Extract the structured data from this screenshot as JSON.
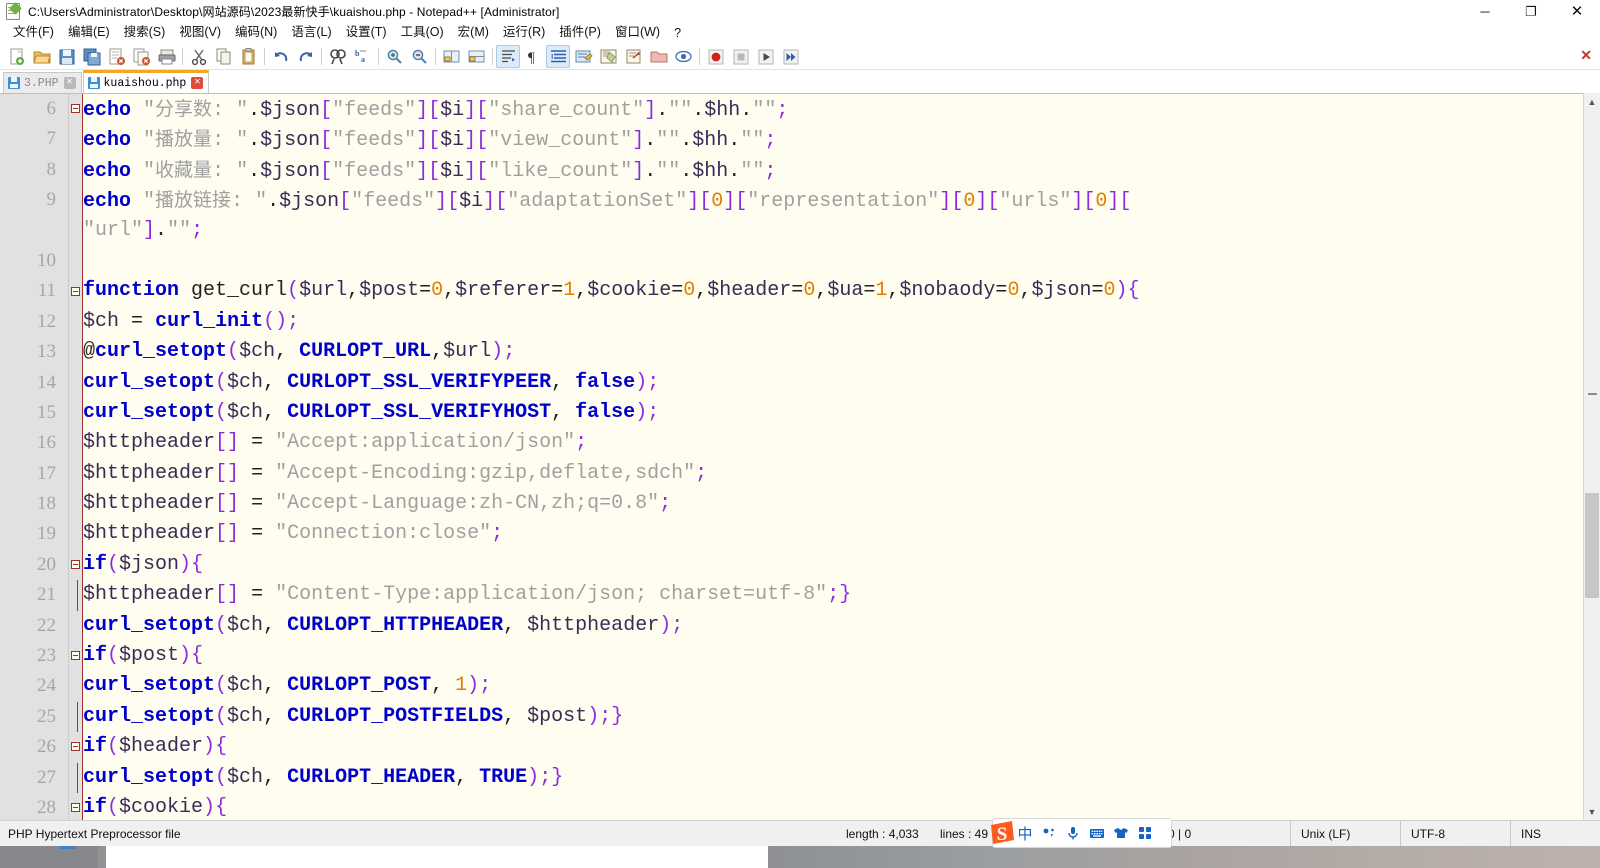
{
  "window": {
    "title": "C:\\Users\\Administrator\\Desktop\\网站源码\\2023最新快手\\kuaishou.php - Notepad++ [Administrator]",
    "app_icon": "notepad-plus-plus-icon",
    "minimize": "─",
    "maximize": "❐",
    "close": "✕"
  },
  "menu": {
    "items": [
      {
        "label": "文件(F)",
        "name": "menu-file"
      },
      {
        "label": "编辑(E)",
        "name": "menu-edit"
      },
      {
        "label": "搜索(S)",
        "name": "menu-search"
      },
      {
        "label": "视图(V)",
        "name": "menu-view"
      },
      {
        "label": "编码(N)",
        "name": "menu-encoding"
      },
      {
        "label": "语言(L)",
        "name": "menu-language"
      },
      {
        "label": "设置(T)",
        "name": "menu-settings"
      },
      {
        "label": "工具(O)",
        "name": "menu-tools"
      },
      {
        "label": "宏(M)",
        "name": "menu-macro"
      },
      {
        "label": "运行(R)",
        "name": "menu-run"
      },
      {
        "label": "插件(P)",
        "name": "menu-plugins"
      },
      {
        "label": "窗口(W)",
        "name": "menu-window"
      }
    ],
    "help": "?"
  },
  "toolbar": {
    "buttons": [
      "new-file-icon",
      "open-file-icon",
      "save-icon",
      "save-all-icon",
      "close-file-icon",
      "close-all-icon",
      "print-icon",
      "sep",
      "cut-icon",
      "copy-icon",
      "paste-icon",
      "sep",
      "undo-icon",
      "redo-icon",
      "sep",
      "find-icon",
      "replace-icon",
      "sep",
      "zoom-in-icon",
      "zoom-out-icon",
      "sep",
      "sync-vertical-icon",
      "sync-horizontal-icon",
      "sep",
      "word-wrap-icon",
      "show-all-chars-icon",
      "indent-guide-icon",
      "user-language-icon",
      "document-map-icon",
      "function-list-icon",
      "folder-as-workspace-icon",
      "monitoring-icon",
      "sep",
      "record-macro-icon",
      "stop-macro-icon",
      "play-macro-icon",
      "fast-play-macro-icon"
    ],
    "close_doc": "✕"
  },
  "tabs": [
    {
      "label": "3.PHP",
      "active": false,
      "name": "tab-3-php",
      "close": "✕"
    },
    {
      "label": "kuaishou.php",
      "active": true,
      "name": "tab-kuaishou-php",
      "close": "✕"
    }
  ],
  "editor": {
    "first_visible_line": 6,
    "language": "PHP",
    "lines": [
      {
        "num": "6",
        "fold": "open-box",
        "html": "<span class=\"kw\">echo</span> <span class=\"str\">\"</span><span class=\"cjk\">分享数</span><span class=\"str\">: \"</span><span class=\"op\">.</span><span class=\"var\">$json</span><span class=\"brk\">[</span><span class=\"str\">\"feeds\"</span><span class=\"brk\">][</span><span class=\"var\">$i</span><span class=\"brk\">][</span><span class=\"str\">\"share_count\"</span><span class=\"brk\">]</span><span class=\"op\">.</span><span class=\"str\">\"\"</span><span class=\"op\">.</span><span class=\"var\">$hh</span><span class=\"op\">.</span><span class=\"str\">\"\"</span><span class=\"semi\">;</span>"
      },
      {
        "num": "7",
        "fold": "",
        "html": "<span class=\"kw\">echo</span> <span class=\"str\">\"</span><span class=\"cjk\">播放量</span><span class=\"str\">: \"</span><span class=\"op\">.</span><span class=\"var\">$json</span><span class=\"brk\">[</span><span class=\"str\">\"feeds\"</span><span class=\"brk\">][</span><span class=\"var\">$i</span><span class=\"brk\">][</span><span class=\"str\">\"view_count\"</span><span class=\"brk\">]</span><span class=\"op\">.</span><span class=\"str\">\"\"</span><span class=\"op\">.</span><span class=\"var\">$hh</span><span class=\"op\">.</span><span class=\"str\">\"\"</span><span class=\"semi\">;</span>"
      },
      {
        "num": "8",
        "fold": "",
        "html": "<span class=\"kw\">echo</span> <span class=\"str\">\"</span><span class=\"cjk\">收藏量</span><span class=\"str\">: \"</span><span class=\"op\">.</span><span class=\"var\">$json</span><span class=\"brk\">[</span><span class=\"str\">\"feeds\"</span><span class=\"brk\">][</span><span class=\"var\">$i</span><span class=\"brk\">][</span><span class=\"str\">\"like_count\"</span><span class=\"brk\">]</span><span class=\"op\">.</span><span class=\"str\">\"\"</span><span class=\"op\">.</span><span class=\"var\">$hh</span><span class=\"op\">.</span><span class=\"str\">\"\"</span><span class=\"semi\">;</span>"
      },
      {
        "num": "9",
        "fold": "",
        "html": "<span class=\"kw\">echo</span> <span class=\"str\">\"</span><span class=\"cjk\">播放链接</span><span class=\"str\">: \"</span><span class=\"op\">.</span><span class=\"var\">$json</span><span class=\"brk\">[</span><span class=\"str\">\"feeds\"</span><span class=\"brk\">][</span><span class=\"var\">$i</span><span class=\"brk\">][</span><span class=\"str\">\"adaptationSet\"</span><span class=\"brk\">][</span><span class=\"num\">0</span><span class=\"brk\">][</span><span class=\"str\">\"representation\"</span><span class=\"brk\">][</span><span class=\"num\">0</span><span class=\"brk\">][</span><span class=\"str\">\"urls\"</span><span class=\"brk\">][</span><span class=\"num\">0</span><span class=\"brk\">][</span>"
      },
      {
        "num": "",
        "fold": "",
        "html": "<span class=\"str\">\"url\"</span><span class=\"brk\">]</span><span class=\"op\">.</span><span class=\"str\">\"\"</span><span class=\"semi\">;</span>"
      },
      {
        "num": "10",
        "fold": "",
        "html": ""
      },
      {
        "num": "11",
        "fold": "open-box",
        "html": "<span class=\"kw\">function</span> <span class=\"op\">get_curl</span><span class=\"brk\">(</span><span class=\"var\">$url</span><span class=\"op\">,</span><span class=\"var\">$post</span><span class=\"op\">=</span><span class=\"num\">0</span><span class=\"op\">,</span><span class=\"var\">$referer</span><span class=\"op\">=</span><span class=\"num\">1</span><span class=\"op\">,</span><span class=\"var\">$cookie</span><span class=\"op\">=</span><span class=\"num\">0</span><span class=\"op\">,</span><span class=\"var\">$header</span><span class=\"op\">=</span><span class=\"num\">0</span><span class=\"op\">,</span><span class=\"var\">$ua</span><span class=\"op\">=</span><span class=\"num\">1</span><span class=\"op\">,</span><span class=\"var\">$nobaody</span><span class=\"op\">=</span><span class=\"num\">0</span><span class=\"op\">,</span><span class=\"var\">$json</span><span class=\"op\">=</span><span class=\"num\">0</span><span class=\"brk\">)</span><span class=\"brk\">{</span>"
      },
      {
        "num": "12",
        "fold": "",
        "html": "<span class=\"var\">$ch</span> <span class=\"op\">=</span> <span class=\"fn\">curl_init</span><span class=\"brk\">()</span><span class=\"semi\">;</span>"
      },
      {
        "num": "13",
        "fold": "",
        "html": "<span class=\"at\">@</span><span class=\"fn\">curl_setopt</span><span class=\"brk\">(</span><span class=\"var\">$ch</span><span class=\"op\">,</span> <span class=\"cst\">CURLOPT_URL</span><span class=\"op\">,</span><span class=\"var\">$url</span><span class=\"brk\">)</span><span class=\"semi\">;</span>"
      },
      {
        "num": "14",
        "fold": "",
        "html": "<span class=\"fn\">curl_setopt</span><span class=\"brk\">(</span><span class=\"var\">$ch</span><span class=\"op\">,</span> <span class=\"cst\">CURLOPT_SSL_VERIFYPEER</span><span class=\"op\">,</span> <span class=\"cst\">false</span><span class=\"brk\">)</span><span class=\"semi\">;</span>"
      },
      {
        "num": "15",
        "fold": "",
        "html": "<span class=\"fn\">curl_setopt</span><span class=\"brk\">(</span><span class=\"var\">$ch</span><span class=\"op\">,</span> <span class=\"cst\">CURLOPT_SSL_VERIFYHOST</span><span class=\"op\">,</span> <span class=\"cst\">false</span><span class=\"brk\">)</span><span class=\"semi\">;</span>"
      },
      {
        "num": "16",
        "fold": "",
        "html": "<span class=\"var\">$httpheader</span><span class=\"brk\">[]</span> <span class=\"op\">=</span> <span class=\"str\">\"Accept:application/json\"</span><span class=\"semi\">;</span>"
      },
      {
        "num": "17",
        "fold": "",
        "html": "<span class=\"var\">$httpheader</span><span class=\"brk\">[]</span> <span class=\"op\">=</span> <span class=\"str\">\"Accept-Encoding:gzip,deflate,sdch\"</span><span class=\"semi\">;</span>"
      },
      {
        "num": "18",
        "fold": "",
        "html": "<span class=\"var\">$httpheader</span><span class=\"brk\">[]</span> <span class=\"op\">=</span> <span class=\"str\">\"Accept-Language:zh-CN,zh;q=0.8\"</span><span class=\"semi\">;</span>"
      },
      {
        "num": "19",
        "fold": "",
        "html": "<span class=\"var\">$httpheader</span><span class=\"brk\">[]</span> <span class=\"op\">=</span> <span class=\"str\">\"Connection:close\"</span><span class=\"semi\">;</span>"
      },
      {
        "num": "20",
        "fold": "open-box",
        "html": "<span class=\"kw\">if</span><span class=\"brk\">(</span><span class=\"var\">$json</span><span class=\"brk\">)</span><span class=\"brk\">{</span>"
      },
      {
        "num": "21",
        "fold": "tail",
        "html": "<span class=\"var\">$httpheader</span><span class=\"brk\">[]</span> <span class=\"op\">=</span> <span class=\"str\">\"Content-Type:application/json; charset=utf-8\"</span><span class=\"semi\">;</span><span class=\"brk\">}</span>"
      },
      {
        "num": "22",
        "fold": "",
        "html": "<span class=\"fn\">curl_setopt</span><span class=\"brk\">(</span><span class=\"var\">$ch</span><span class=\"op\">,</span> <span class=\"cst\">CURLOPT_HTTPHEADER</span><span class=\"op\">,</span> <span class=\"var\">$httpheader</span><span class=\"brk\">)</span><span class=\"semi\">;</span>"
      },
      {
        "num": "23",
        "fold": "open-box",
        "html": "<span class=\"kw\">if</span><span class=\"brk\">(</span><span class=\"var\">$post</span><span class=\"brk\">)</span><span class=\"brk\">{</span>"
      },
      {
        "num": "24",
        "fold": "",
        "html": "<span class=\"fn\">curl_setopt</span><span class=\"brk\">(</span><span class=\"var\">$ch</span><span class=\"op\">,</span> <span class=\"cst\">CURLOPT_POST</span><span class=\"op\">,</span> <span class=\"num\">1</span><span class=\"brk\">)</span><span class=\"semi\">;</span>"
      },
      {
        "num": "25",
        "fold": "tail",
        "html": "<span class=\"fn\">curl_setopt</span><span class=\"brk\">(</span><span class=\"var\">$ch</span><span class=\"op\">,</span> <span class=\"cst\">CURLOPT_POSTFIELDS</span><span class=\"op\">,</span> <span class=\"var\">$post</span><span class=\"brk\">)</span><span class=\"semi\">;</span><span class=\"brk\">}</span>"
      },
      {
        "num": "26",
        "fold": "open-box",
        "html": "<span class=\"kw\">if</span><span class=\"brk\">(</span><span class=\"var\">$header</span><span class=\"brk\">)</span><span class=\"brk\">{</span>"
      },
      {
        "num": "27",
        "fold": "tail",
        "html": "<span class=\"fn\">curl_setopt</span><span class=\"brk\">(</span><span class=\"var\">$ch</span><span class=\"op\">,</span> <span class=\"cst\">CURLOPT_HEADER</span><span class=\"op\">,</span> <span class=\"cst\">TRUE</span><span class=\"brk\">)</span><span class=\"semi\">;</span><span class=\"brk\">}</span>"
      },
      {
        "num": "28",
        "fold": "open-box",
        "html": "<span class=\"kw\">if</span><span class=\"brk\">(</span><span class=\"var\">$cookie</span><span class=\"brk\">)</span><span class=\"brk\">{</span>"
      }
    ]
  },
  "statusbar": {
    "file_type": "PHP Hypertext Preprocessor file",
    "length_label": "length : 4,033",
    "lines_label": "lines : 49",
    "caret": "0 | 0",
    "eol": "Unix (LF)",
    "encoding": "UTF-8",
    "insert_mode": "INS"
  },
  "ime": {
    "name": "sogou-input-method",
    "logo": "S",
    "mode": "中",
    "icons": [
      "half-full-width-icon",
      "voice-input-icon",
      "soft-keyboard-icon",
      "skin-icon",
      "toolbox-icon"
    ]
  },
  "colors": {
    "keyword": "#0000cc",
    "string": "#a0a0a0",
    "variable": "#3b2a55",
    "number": "#e08000",
    "bracket": "#8a2be2",
    "editor_bg": "#fffdf0",
    "gutter_bg": "#e1e1e1",
    "tab_accent": "#f5a623"
  }
}
